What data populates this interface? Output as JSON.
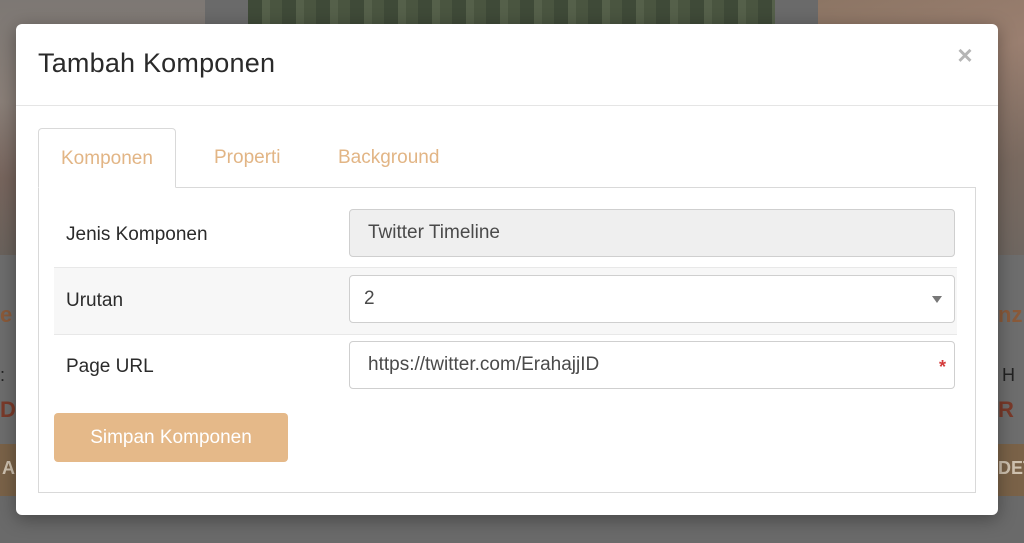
{
  "background": {
    "left_partial_text": "e",
    "left_partial_amount": "D,",
    "left_partial_button": "A",
    "right_partial_text": "nz",
    "right_partial_amount": "R",
    "right_partial_button": "DET",
    "left_colon": ":",
    "right_letter": "H"
  },
  "modal": {
    "title": "Tambah Komponen",
    "close_glyph": "×",
    "tabs": [
      {
        "label": "Komponen",
        "active": true
      },
      {
        "label": "Properti",
        "active": false
      },
      {
        "label": "Background",
        "active": false
      }
    ],
    "form": {
      "jenis_label": "Jenis Komponen",
      "jenis_value": "Twitter Timeline",
      "urutan_label": "Urutan",
      "urutan_value": "2",
      "page_url_label": "Page URL",
      "page_url_value": "https://twitter.com/ErahajjID",
      "required_mark": "*"
    },
    "submit_label": "Simpan Komponen"
  },
  "colors": {
    "accent": "#e5b989",
    "tab_text": "#e2b585",
    "required": "#d43b3b"
  }
}
